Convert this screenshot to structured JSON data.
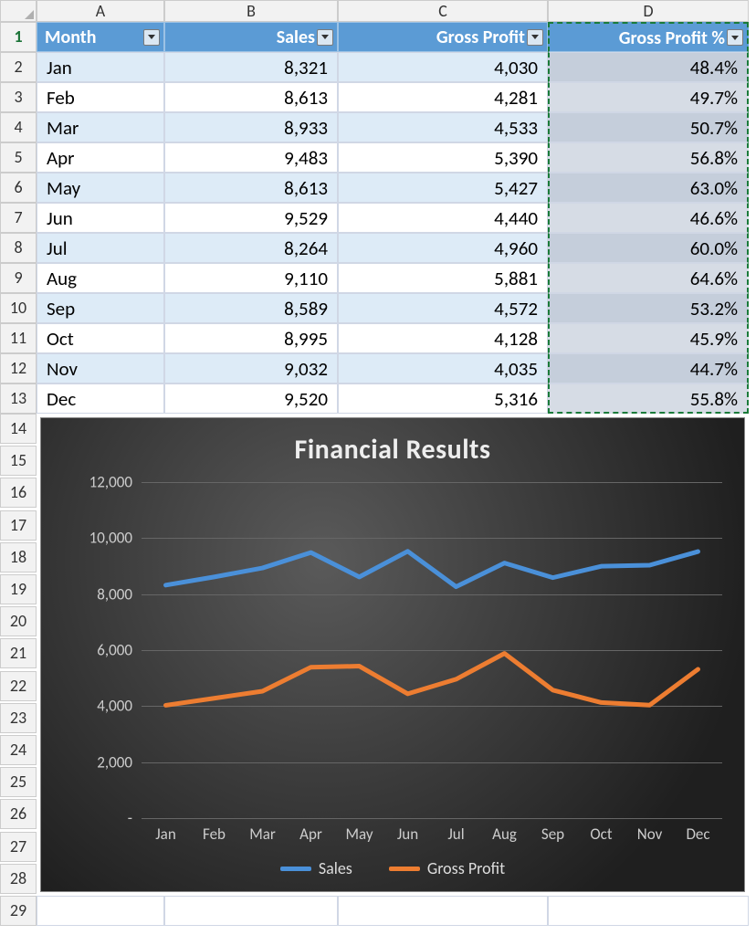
{
  "columns": [
    "A",
    "B",
    "C",
    "D"
  ],
  "row_headers": [
    1,
    2,
    3,
    4,
    5,
    6,
    7,
    8,
    9,
    10,
    11,
    12,
    13,
    14,
    15,
    16,
    17,
    18,
    19,
    20,
    21,
    22,
    23,
    24,
    25,
    26,
    27,
    28,
    29
  ],
  "table": {
    "headers": {
      "month": "Month",
      "sales": "Sales",
      "gross_profit": "Gross Profit",
      "gross_profit_pct": "Gross Profit %"
    },
    "rows": [
      {
        "month": "Jan",
        "sales": "8,321",
        "gp": "4,030",
        "pct": "48.4%"
      },
      {
        "month": "Feb",
        "sales": "8,613",
        "gp": "4,281",
        "pct": "49.7%"
      },
      {
        "month": "Mar",
        "sales": "8,933",
        "gp": "4,533",
        "pct": "50.7%"
      },
      {
        "month": "Apr",
        "sales": "9,483",
        "gp": "5,390",
        "pct": "56.8%"
      },
      {
        "month": "May",
        "sales": "8,613",
        "gp": "5,427",
        "pct": "63.0%"
      },
      {
        "month": "Jun",
        "sales": "9,529",
        "gp": "4,440",
        "pct": "46.6%"
      },
      {
        "month": "Jul",
        "sales": "8,264",
        "gp": "4,960",
        "pct": "60.0%"
      },
      {
        "month": "Aug",
        "sales": "9,110",
        "gp": "5,881",
        "pct": "64.6%"
      },
      {
        "month": "Sep",
        "sales": "8,589",
        "gp": "4,572",
        "pct": "53.2%"
      },
      {
        "month": "Oct",
        "sales": "8,995",
        "gp": "4,128",
        "pct": "45.9%"
      },
      {
        "month": "Nov",
        "sales": "9,032",
        "gp": "4,035",
        "pct": "44.7%"
      },
      {
        "month": "Dec",
        "sales": "9,520",
        "gp": "5,316",
        "pct": "55.8%"
      }
    ]
  },
  "chart_data": {
    "type": "line",
    "title": "Financial Results",
    "xlabel": "",
    "ylabel": "",
    "ylim": [
      0,
      12000
    ],
    "yticks": [
      "-",
      "2,000",
      "4,000",
      "6,000",
      "8,000",
      "10,000",
      "12,000"
    ],
    "ytick_vals": [
      0,
      2000,
      4000,
      6000,
      8000,
      10000,
      12000
    ],
    "categories": [
      "Jan",
      "Feb",
      "Mar",
      "Apr",
      "May",
      "Jun",
      "Jul",
      "Aug",
      "Sep",
      "Oct",
      "Nov",
      "Dec"
    ],
    "series": [
      {
        "name": "Sales",
        "color": "#4a90d9",
        "values": [
          8321,
          8613,
          8933,
          9483,
          8613,
          9529,
          8264,
          9110,
          8589,
          8995,
          9032,
          9520
        ]
      },
      {
        "name": "Gross Profit",
        "color": "#ed7d31",
        "values": [
          4030,
          4281,
          4533,
          5390,
          5427,
          4440,
          4960,
          5881,
          4572,
          4128,
          4035,
          5316
        ]
      }
    ]
  }
}
